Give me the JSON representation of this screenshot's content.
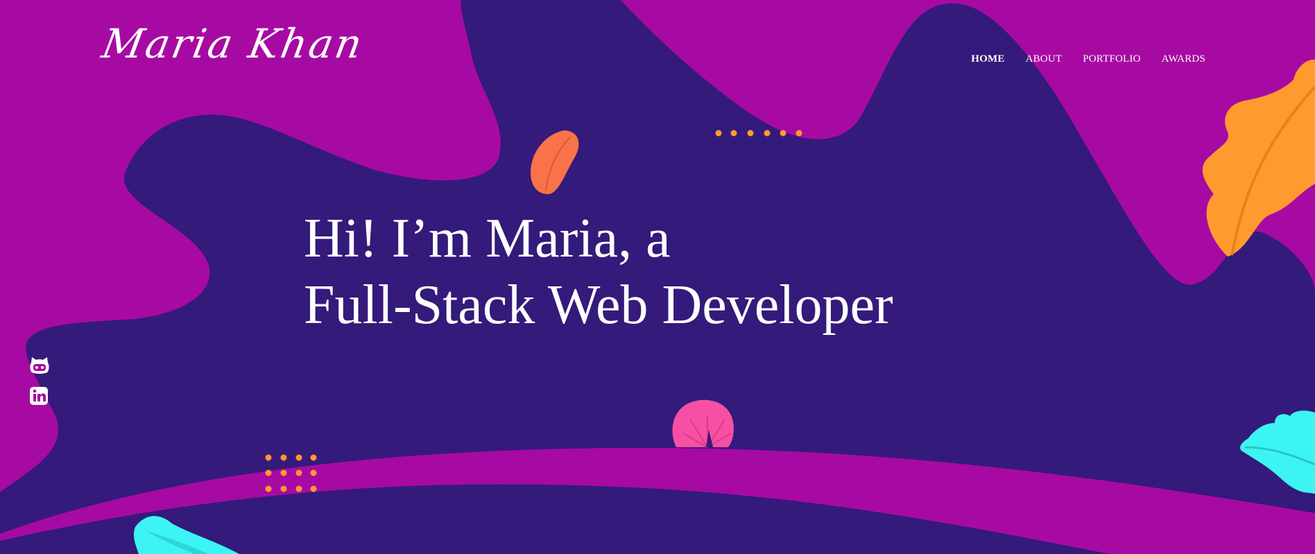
{
  "brand": {
    "logo_text": "Maria Khan"
  },
  "nav": {
    "items": [
      {
        "label": "HOME",
        "active": true
      },
      {
        "label": "ABOUT",
        "active": false
      },
      {
        "label": "PORTFOLIO",
        "active": false
      },
      {
        "label": "AWARDS",
        "active": false
      }
    ]
  },
  "hero": {
    "line1": "Hi! I’m Maria, a",
    "line2": "Full-Stack Web Developer"
  },
  "social": {
    "github_icon": "github-icon",
    "linkedin_icon": "linkedin-icon"
  },
  "colors": {
    "magenta": "#a70aa3",
    "indigo": "#341a7a",
    "orange": "#ff9a2e",
    "coral": "#f9724a",
    "pink": "#f74fa4",
    "cyan": "#3cf4f4"
  }
}
